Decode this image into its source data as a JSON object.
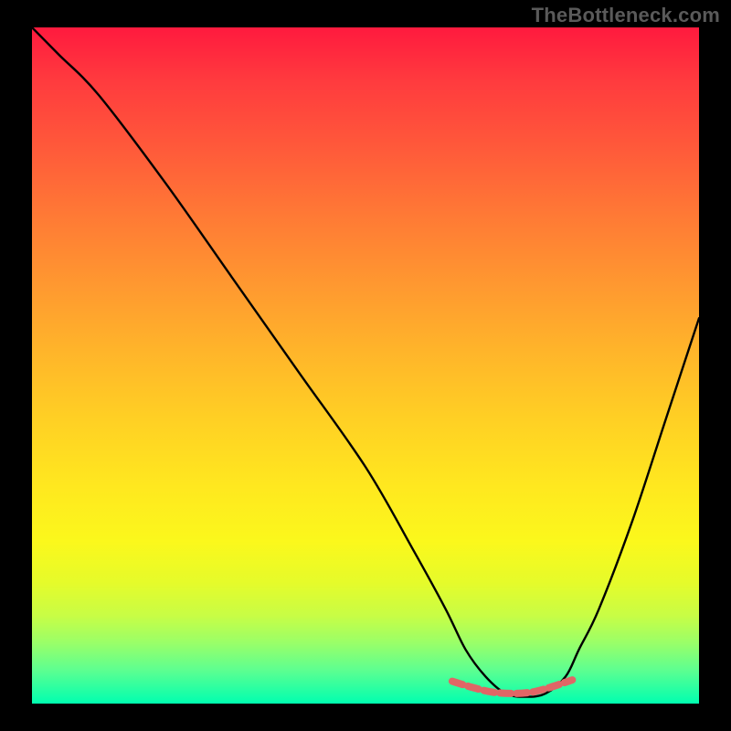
{
  "watermark": "TheBottleneck.com",
  "chart_data": {
    "type": "line",
    "title": "",
    "xlabel": "",
    "ylabel": "",
    "xlim": [
      0,
      100
    ],
    "ylim": [
      0,
      100
    ],
    "series": [
      {
        "name": "bottleneck-curve",
        "x": [
          0,
          4,
          10,
          20,
          30,
          40,
          50,
          57,
          62,
          65,
          68,
          71,
          74,
          77,
          80,
          82,
          85,
          90,
          95,
          100
        ],
        "values": [
          100,
          96,
          90,
          77,
          63,
          49,
          35,
          23,
          14,
          8,
          4,
          1.5,
          1,
          1.5,
          4,
          8,
          14,
          27,
          42,
          57
        ]
      },
      {
        "name": "highlight-band",
        "x": [
          63,
          66,
          69,
          72,
          75,
          78,
          81
        ],
        "values": [
          3.3,
          2.4,
          1.7,
          1.5,
          1.7,
          2.5,
          3.5
        ]
      }
    ],
    "gradient_stops": [
      {
        "pos": 0,
        "color": "#ff1a3e"
      },
      {
        "pos": 8,
        "color": "#ff3b3e"
      },
      {
        "pos": 18,
        "color": "#ff5a3a"
      },
      {
        "pos": 28,
        "color": "#ff7a35"
      },
      {
        "pos": 38,
        "color": "#ff9830"
      },
      {
        "pos": 48,
        "color": "#ffb52a"
      },
      {
        "pos": 58,
        "color": "#ffd024"
      },
      {
        "pos": 68,
        "color": "#ffe81f"
      },
      {
        "pos": 76,
        "color": "#fbf81c"
      },
      {
        "pos": 82,
        "color": "#e6fb2a"
      },
      {
        "pos": 87,
        "color": "#c8fd45"
      },
      {
        "pos": 91,
        "color": "#9aff68"
      },
      {
        "pos": 95,
        "color": "#5eff90"
      },
      {
        "pos": 100,
        "color": "#00ffb0"
      }
    ],
    "colors": {
      "curve": "#000000",
      "highlight": "#e06666",
      "background_frame": "#000000"
    }
  }
}
